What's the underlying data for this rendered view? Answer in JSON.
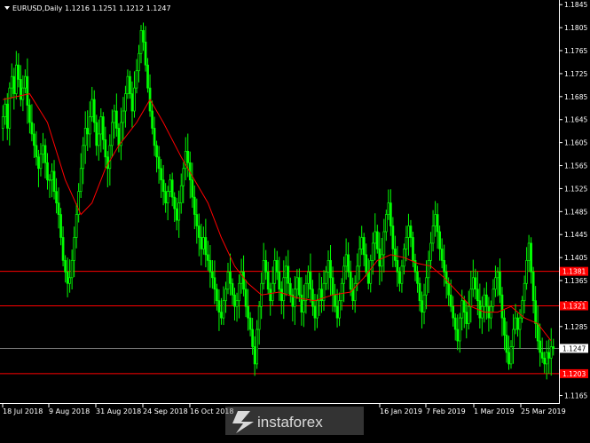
{
  "header": {
    "arrow_icon": "triangle-down-icon",
    "symbol": "EURUSD,Daily",
    "ohlc": "1.1216 1.1251 1.1212 1.1247"
  },
  "watermark": {
    "text": "instaforex",
    "icon": "instaforex-logo-icon"
  },
  "colors": {
    "background": "#000000",
    "candles": "#00ff00",
    "moving_average": "#ff0000",
    "levels": "#ff0000",
    "current_price_line": "#c0c0c0",
    "axis_text": "#ffffff"
  },
  "chart_data": {
    "type": "candlestick",
    "symbol": "EURUSD",
    "timeframe": "Daily",
    "ylim": [
      1.1155,
      1.185
    ],
    "yticks": [
      "1.1845",
      "1.1805",
      "1.1765",
      "1.1725",
      "1.1685",
      "1.1645",
      "1.1605",
      "1.1565",
      "1.1525",
      "1.1485",
      "1.1445",
      "1.1405",
      "1.1365",
      "1.1325",
      "1.1285",
      "1.1245",
      "1.1205",
      "1.1165"
    ],
    "xticks": [
      {
        "label": "18 Jul 2018",
        "date": "2018-07-18"
      },
      {
        "label": "9 Aug 2018",
        "date": "2018-08-09"
      },
      {
        "label": "31 Aug 2018",
        "date": "2018-08-31"
      },
      {
        "label": "24 Sep 2018",
        "date": "2018-09-24"
      },
      {
        "label": "16 Oct 2018",
        "date": "2018-10-16"
      },
      {
        "label": "16 Jan 2019",
        "date": "2019-01-16"
      },
      {
        "label": "7 Feb 2019",
        "date": "2019-02-07"
      },
      {
        "label": "1 Mar 2019",
        "date": "2019-03-01"
      },
      {
        "label": "25 Mar 2019",
        "date": "2019-03-25"
      }
    ],
    "levels": [
      {
        "value": 1.1381,
        "label": "1.1381"
      },
      {
        "value": 1.1321,
        "label": "1.1321"
      },
      {
        "value": 1.1203,
        "label": "1.1203"
      }
    ],
    "current_price": {
      "value": 1.1247,
      "label": "1.1247"
    },
    "closes": [
      1.165,
      1.1672,
      1.163,
      1.17,
      1.172,
      1.169,
      1.174,
      1.1715,
      1.168,
      1.17,
      1.172,
      1.167,
      1.164,
      1.162,
      1.16,
      1.158,
      1.156,
      1.1585,
      1.16,
      1.157,
      1.154,
      1.154,
      1.1555,
      1.152,
      1.15,
      1.148,
      1.144,
      1.14,
      1.138,
      1.136,
      1.137,
      1.14,
      1.144,
      1.148,
      1.152,
      1.156,
      1.16,
      1.163,
      1.162,
      1.165,
      1.168,
      1.164,
      1.16,
      1.162,
      1.165,
      1.161,
      1.158,
      1.156,
      1.16,
      1.164,
      1.166,
      1.163,
      1.16,
      1.164,
      1.166,
      1.169,
      1.172,
      1.169,
      1.166,
      1.17,
      1.173,
      1.176,
      1.18,
      1.178,
      1.174,
      1.17,
      1.166,
      1.163,
      1.16,
      1.158,
      1.156,
      1.154,
      1.152,
      1.15,
      1.152,
      1.154,
      1.151,
      1.149,
      1.147,
      1.15,
      1.153,
      1.156,
      1.159,
      1.157,
      1.154,
      1.151,
      1.148,
      1.146,
      1.144,
      1.142,
      1.144,
      1.141,
      1.14,
      1.138,
      1.137,
      1.135,
      1.133,
      1.131,
      1.13,
      1.133,
      1.135,
      1.138,
      1.136,
      1.134,
      1.132,
      1.133,
      1.136,
      1.138,
      1.135,
      1.132,
      1.13,
      1.128,
      1.125,
      1.122,
      1.128,
      1.132,
      1.136,
      1.14,
      1.138,
      1.135,
      1.133,
      1.136,
      1.14,
      1.138,
      1.135,
      1.133,
      1.137,
      1.139,
      1.136,
      1.134,
      1.132,
      1.135,
      1.137,
      1.134,
      1.131,
      1.133,
      1.136,
      1.138,
      1.135,
      1.132,
      1.13,
      1.133,
      1.135,
      1.133,
      1.136,
      1.138,
      1.14,
      1.137,
      1.134,
      1.132,
      1.13,
      1.133,
      1.136,
      1.139,
      1.141,
      1.138,
      1.135,
      1.133,
      1.136,
      1.139,
      1.142,
      1.144,
      1.141,
      1.138,
      1.136,
      1.14,
      1.143,
      1.145,
      1.142,
      1.139,
      1.141,
      1.145,
      1.148,
      1.15,
      1.146,
      1.142,
      1.14,
      1.138,
      1.136,
      1.139,
      1.142,
      1.144,
      1.146,
      1.144,
      1.14,
      1.138,
      1.136,
      1.133,
      1.131,
      1.134,
      1.137,
      1.14,
      1.143,
      1.146,
      1.148,
      1.145,
      1.142,
      1.14,
      1.138,
      1.136,
      1.134,
      1.132,
      1.13,
      1.128,
      1.126,
      1.13,
      1.133,
      1.131,
      1.129,
      1.132,
      1.135,
      1.137,
      1.135,
      1.133,
      1.13,
      1.132,
      1.134,
      1.132,
      1.13,
      1.132,
      1.135,
      1.137,
      1.138,
      1.134,
      1.13,
      1.127,
      1.124,
      1.122,
      1.125,
      1.128,
      1.13,
      1.128,
      1.13,
      1.133,
      1.136,
      1.14,
      1.143,
      1.138,
      1.133,
      1.129,
      1.126,
      1.124,
      1.123,
      1.122,
      1.124,
      1.123,
      1.125,
      1.1247
    ],
    "ma_points": [
      [
        0,
        1.168
      ],
      [
        12,
        1.169
      ],
      [
        20,
        1.164
      ],
      [
        28,
        1.154
      ],
      [
        35,
        1.148
      ],
      [
        40,
        1.15
      ],
      [
        46,
        1.156
      ],
      [
        52,
        1.16
      ],
      [
        60,
        1.164
      ],
      [
        66,
        1.168
      ],
      [
        72,
        1.164
      ],
      [
        80,
        1.158
      ],
      [
        86,
        1.154
      ],
      [
        92,
        1.15
      ],
      [
        98,
        1.144
      ],
      [
        104,
        1.139
      ],
      [
        110,
        1.136
      ],
      [
        116,
        1.134
      ],
      [
        124,
        1.1345
      ],
      [
        132,
        1.1335
      ],
      [
        140,
        1.133
      ],
      [
        148,
        1.134
      ],
      [
        156,
        1.1345
      ],
      [
        162,
        1.137
      ],
      [
        168,
        1.14
      ],
      [
        174,
        1.141
      ],
      [
        180,
        1.1405
      ],
      [
        186,
        1.1395
      ],
      [
        192,
        1.139
      ],
      [
        198,
        1.137
      ],
      [
        204,
        1.1345
      ],
      [
        210,
        1.132
      ],
      [
        216,
        1.131
      ],
      [
        222,
        1.131
      ],
      [
        228,
        1.132
      ],
      [
        234,
        1.13
      ],
      [
        240,
        1.129
      ],
      [
        246,
        1.126
      ]
    ]
  }
}
